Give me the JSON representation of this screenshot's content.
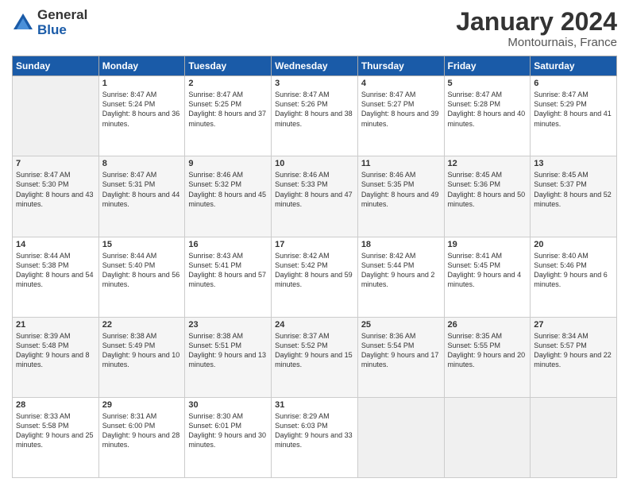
{
  "logo": {
    "general": "General",
    "blue": "Blue"
  },
  "title": "January 2024",
  "subtitle": "Montournais, France",
  "days": [
    "Sunday",
    "Monday",
    "Tuesday",
    "Wednesday",
    "Thursday",
    "Friday",
    "Saturday"
  ],
  "weeks": [
    [
      {
        "num": "",
        "sunrise": "",
        "sunset": "",
        "daylight": ""
      },
      {
        "num": "1",
        "sunrise": "Sunrise: 8:47 AM",
        "sunset": "Sunset: 5:24 PM",
        "daylight": "Daylight: 8 hours and 36 minutes."
      },
      {
        "num": "2",
        "sunrise": "Sunrise: 8:47 AM",
        "sunset": "Sunset: 5:25 PM",
        "daylight": "Daylight: 8 hours and 37 minutes."
      },
      {
        "num": "3",
        "sunrise": "Sunrise: 8:47 AM",
        "sunset": "Sunset: 5:26 PM",
        "daylight": "Daylight: 8 hours and 38 minutes."
      },
      {
        "num": "4",
        "sunrise": "Sunrise: 8:47 AM",
        "sunset": "Sunset: 5:27 PM",
        "daylight": "Daylight: 8 hours and 39 minutes."
      },
      {
        "num": "5",
        "sunrise": "Sunrise: 8:47 AM",
        "sunset": "Sunset: 5:28 PM",
        "daylight": "Daylight: 8 hours and 40 minutes."
      },
      {
        "num": "6",
        "sunrise": "Sunrise: 8:47 AM",
        "sunset": "Sunset: 5:29 PM",
        "daylight": "Daylight: 8 hours and 41 minutes."
      }
    ],
    [
      {
        "num": "7",
        "sunrise": "Sunrise: 8:47 AM",
        "sunset": "Sunset: 5:30 PM",
        "daylight": "Daylight: 8 hours and 43 minutes."
      },
      {
        "num": "8",
        "sunrise": "Sunrise: 8:47 AM",
        "sunset": "Sunset: 5:31 PM",
        "daylight": "Daylight: 8 hours and 44 minutes."
      },
      {
        "num": "9",
        "sunrise": "Sunrise: 8:46 AM",
        "sunset": "Sunset: 5:32 PM",
        "daylight": "Daylight: 8 hours and 45 minutes."
      },
      {
        "num": "10",
        "sunrise": "Sunrise: 8:46 AM",
        "sunset": "Sunset: 5:33 PM",
        "daylight": "Daylight: 8 hours and 47 minutes."
      },
      {
        "num": "11",
        "sunrise": "Sunrise: 8:46 AM",
        "sunset": "Sunset: 5:35 PM",
        "daylight": "Daylight: 8 hours and 49 minutes."
      },
      {
        "num": "12",
        "sunrise": "Sunrise: 8:45 AM",
        "sunset": "Sunset: 5:36 PM",
        "daylight": "Daylight: 8 hours and 50 minutes."
      },
      {
        "num": "13",
        "sunrise": "Sunrise: 8:45 AM",
        "sunset": "Sunset: 5:37 PM",
        "daylight": "Daylight: 8 hours and 52 minutes."
      }
    ],
    [
      {
        "num": "14",
        "sunrise": "Sunrise: 8:44 AM",
        "sunset": "Sunset: 5:38 PM",
        "daylight": "Daylight: 8 hours and 54 minutes."
      },
      {
        "num": "15",
        "sunrise": "Sunrise: 8:44 AM",
        "sunset": "Sunset: 5:40 PM",
        "daylight": "Daylight: 8 hours and 56 minutes."
      },
      {
        "num": "16",
        "sunrise": "Sunrise: 8:43 AM",
        "sunset": "Sunset: 5:41 PM",
        "daylight": "Daylight: 8 hours and 57 minutes."
      },
      {
        "num": "17",
        "sunrise": "Sunrise: 8:42 AM",
        "sunset": "Sunset: 5:42 PM",
        "daylight": "Daylight: 8 hours and 59 minutes."
      },
      {
        "num": "18",
        "sunrise": "Sunrise: 8:42 AM",
        "sunset": "Sunset: 5:44 PM",
        "daylight": "Daylight: 9 hours and 2 minutes."
      },
      {
        "num": "19",
        "sunrise": "Sunrise: 8:41 AM",
        "sunset": "Sunset: 5:45 PM",
        "daylight": "Daylight: 9 hours and 4 minutes."
      },
      {
        "num": "20",
        "sunrise": "Sunrise: 8:40 AM",
        "sunset": "Sunset: 5:46 PM",
        "daylight": "Daylight: 9 hours and 6 minutes."
      }
    ],
    [
      {
        "num": "21",
        "sunrise": "Sunrise: 8:39 AM",
        "sunset": "Sunset: 5:48 PM",
        "daylight": "Daylight: 9 hours and 8 minutes."
      },
      {
        "num": "22",
        "sunrise": "Sunrise: 8:38 AM",
        "sunset": "Sunset: 5:49 PM",
        "daylight": "Daylight: 9 hours and 10 minutes."
      },
      {
        "num": "23",
        "sunrise": "Sunrise: 8:38 AM",
        "sunset": "Sunset: 5:51 PM",
        "daylight": "Daylight: 9 hours and 13 minutes."
      },
      {
        "num": "24",
        "sunrise": "Sunrise: 8:37 AM",
        "sunset": "Sunset: 5:52 PM",
        "daylight": "Daylight: 9 hours and 15 minutes."
      },
      {
        "num": "25",
        "sunrise": "Sunrise: 8:36 AM",
        "sunset": "Sunset: 5:54 PM",
        "daylight": "Daylight: 9 hours and 17 minutes."
      },
      {
        "num": "26",
        "sunrise": "Sunrise: 8:35 AM",
        "sunset": "Sunset: 5:55 PM",
        "daylight": "Daylight: 9 hours and 20 minutes."
      },
      {
        "num": "27",
        "sunrise": "Sunrise: 8:34 AM",
        "sunset": "Sunset: 5:57 PM",
        "daylight": "Daylight: 9 hours and 22 minutes."
      }
    ],
    [
      {
        "num": "28",
        "sunrise": "Sunrise: 8:33 AM",
        "sunset": "Sunset: 5:58 PM",
        "daylight": "Daylight: 9 hours and 25 minutes."
      },
      {
        "num": "29",
        "sunrise": "Sunrise: 8:31 AM",
        "sunset": "Sunset: 6:00 PM",
        "daylight": "Daylight: 9 hours and 28 minutes."
      },
      {
        "num": "30",
        "sunrise": "Sunrise: 8:30 AM",
        "sunset": "Sunset: 6:01 PM",
        "daylight": "Daylight: 9 hours and 30 minutes."
      },
      {
        "num": "31",
        "sunrise": "Sunrise: 8:29 AM",
        "sunset": "Sunset: 6:03 PM",
        "daylight": "Daylight: 9 hours and 33 minutes."
      },
      {
        "num": "",
        "sunrise": "",
        "sunset": "",
        "daylight": ""
      },
      {
        "num": "",
        "sunrise": "",
        "sunset": "",
        "daylight": ""
      },
      {
        "num": "",
        "sunrise": "",
        "sunset": "",
        "daylight": ""
      }
    ]
  ]
}
